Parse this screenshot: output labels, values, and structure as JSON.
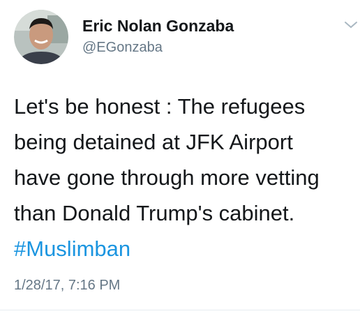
{
  "author": {
    "display_name": "Eric Nolan Gonzaba",
    "handle": "@EGonzaba"
  },
  "tweet": {
    "lines": [
      "Let's be honest : The refugees",
      "being detained at JFK Airport",
      "have gone through more vetting",
      "than Donald Trump's cabinet."
    ],
    "hashtag": "#Muslimban",
    "timestamp": "1/28/17, 7:16 PM"
  },
  "icons": {
    "menu": "chevron-down-icon",
    "avatar": "avatar"
  },
  "colors": {
    "hashtag": "#1b95e0",
    "secondary_text": "#657786",
    "primary_text": "#14171a"
  }
}
